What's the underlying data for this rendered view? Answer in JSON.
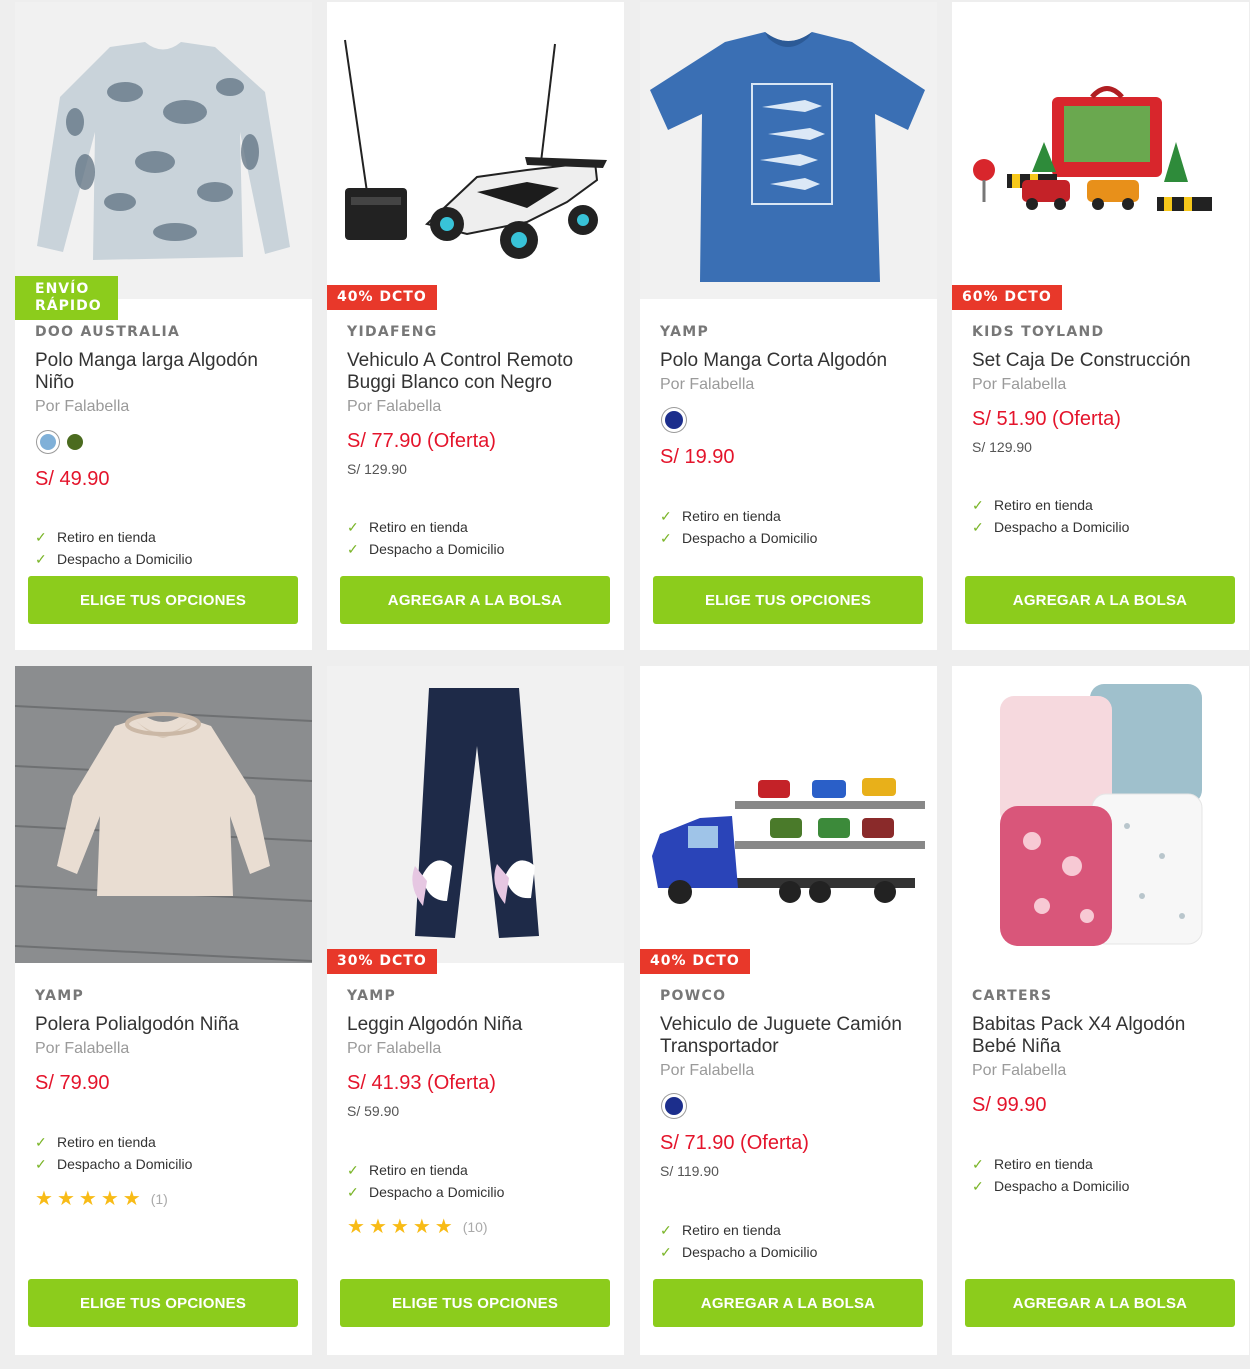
{
  "colors": {
    "accent_green": "#8ccc1c",
    "sale_red": "#e8382a",
    "price_red": "#e4142b",
    "star": "#f8bb16"
  },
  "products": [
    {
      "brand": "DOO AUSTRALIA",
      "title": "Polo Manga larga Algodón Niño",
      "seller": "Por Falabella",
      "badge": "ENVÍO RÁPIDO",
      "swatches": [
        "#7fb0d8",
        "#4b6b1f"
      ],
      "price": "S/ 49.90",
      "delivery": [
        "Retiro en tienda",
        "Despacho a Domicilio"
      ],
      "button": "ELIGE TUS OPCIONES",
      "image": "tie-dye-long-sleeve-shirt"
    },
    {
      "brand": "YIDAFENG",
      "title": "Vehiculo A Control Remoto Buggi Blanco con Negro",
      "seller": "Por Falabella",
      "badge": "40% DCTO",
      "price": "S/ 77.90 (Oferta)",
      "old_price": "S/ 129.90",
      "delivery": [
        "Retiro en tienda",
        "Despacho a Domicilio"
      ],
      "button": "AGREGAR A LA BOLSA",
      "image": "rc-buggy-car"
    },
    {
      "brand": "YAMP",
      "title": "Polo Manga Corta Algodón",
      "seller": "Por Falabella",
      "swatches": [
        "#1c2e8c"
      ],
      "price": "S/ 19.90",
      "delivery": [
        "Retiro en tienda",
        "Despacho a Domicilio"
      ],
      "button": "ELIGE TUS OPCIONES",
      "image": "blue-shark-tshirt"
    },
    {
      "brand": "KIDS TOYLAND",
      "title": "Set Caja De Construcción",
      "seller": "Por Falabella",
      "badge": "60% DCTO",
      "price": "S/ 51.90 (Oferta)",
      "old_price": "S/ 129.90",
      "delivery": [
        "Retiro en tienda",
        "Despacho a Domicilio"
      ],
      "button": "AGREGAR A LA BOLSA",
      "image": "construction-toy-set"
    },
    {
      "brand": "YAMP",
      "title": "Polera Polialgodón Niña",
      "seller": "Por Falabella",
      "price": "S/ 79.90",
      "delivery": [
        "Retiro en tienda",
        "Despacho a Domicilio"
      ],
      "rating": 5,
      "reviews": "(1)",
      "button": "ELIGE TUS OPCIONES",
      "image": "beige-ruffle-blouse"
    },
    {
      "brand": "YAMP",
      "title": "Leggin Algodón Niña",
      "seller": "Por Falabella",
      "badge": "30% DCTO",
      "price": "S/ 41.93 (Oferta)",
      "old_price": "S/ 59.90",
      "delivery": [
        "Retiro en tienda",
        "Despacho a Domicilio"
      ],
      "rating": 5,
      "reviews": "(10)",
      "button": "ELIGE TUS OPCIONES",
      "image": "unicorn-leggings"
    },
    {
      "brand": "POWCO",
      "title": "Vehiculo de Juguete Camión Transportador",
      "seller": "Por Falabella",
      "badge": "40% DCTO",
      "swatches": [
        "#1c2e8c"
      ],
      "price": "S/ 71.90 (Oferta)",
      "old_price": "S/ 119.90",
      "delivery": [
        "Retiro en tienda",
        "Despacho a Domicilio"
      ],
      "button": "AGREGAR A LA BOLSA",
      "image": "car-transporter-truck"
    },
    {
      "brand": "CARTERS",
      "title": "Babitas Pack X4 Algodón Bebé Niña",
      "seller": "Por Falabella",
      "price": "S/ 99.90",
      "delivery": [
        "Retiro en tienda",
        "Despacho a Domicilio"
      ],
      "button": "AGREGAR A LA BOLSA",
      "image": "burp-cloth-pack"
    }
  ]
}
